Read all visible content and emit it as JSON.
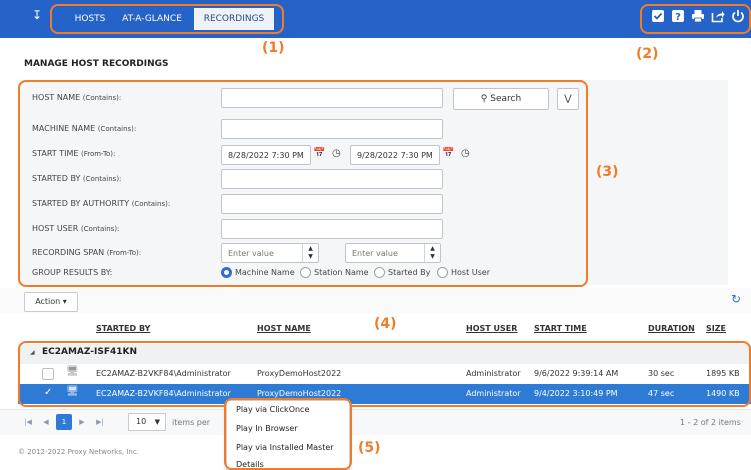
{
  "colors": {
    "topbar": "#2563c9",
    "accent": "#2e7bd6",
    "callout": "#f07c2a"
  },
  "nav": {
    "menu_icon": "double-chevron-down-icon",
    "tabs": [
      {
        "label": "HOSTS"
      },
      {
        "label": "AT-A-GLANCE"
      },
      {
        "label": "RECORDINGS",
        "active": true
      }
    ],
    "tool_icons": [
      "checkbox-icon",
      "help-icon",
      "print-icon",
      "share-icon",
      "power-icon"
    ]
  },
  "callouts": [
    "(1)",
    "(2)",
    "(3)",
    "(4)",
    "(5)"
  ],
  "page_title": "MANAGE HOST RECORDINGS",
  "filters": {
    "host_name": {
      "label": "HOST NAME",
      "hint": "(Contains):",
      "value": ""
    },
    "search_button": "Search",
    "search_icon": "search-icon",
    "reset_icon": "filter-clear-icon",
    "machine_name": {
      "label": "MACHINE NAME",
      "hint": "(Contains):",
      "value": ""
    },
    "start_time": {
      "label": "START TIME",
      "hint": "(From-To):",
      "from": "8/28/2022 7:30 PM",
      "to": "9/28/2022 7:30 PM"
    },
    "started_by": {
      "label": "STARTED BY",
      "hint": "(Contains):",
      "value": ""
    },
    "started_by_authority": {
      "label": "STARTED BY AUTHORITY",
      "hint": "(Contains):",
      "value": ""
    },
    "host_user": {
      "label": "HOST USER",
      "hint": "(Contains):",
      "value": ""
    },
    "recording_span": {
      "label": "RECORDING SPAN",
      "hint": "(From-To):",
      "from_placeholder": "Enter value",
      "to_placeholder": "Enter value"
    },
    "group_results": {
      "label": "GROUP RESULTS BY:",
      "options": [
        "Machine Name",
        "Station Name",
        "Started By",
        "Host User"
      ],
      "selected": "Machine Name"
    }
  },
  "grid": {
    "action_label": "Action ▾",
    "columns": [
      "STARTED BY",
      "HOST NAME",
      "HOST USER",
      "START TIME",
      "DURATION",
      "SIZE"
    ],
    "group": {
      "label": "EC2AMAZ-ISF41KN"
    },
    "rows": [
      {
        "started_by": "EC2AMAZ-B2VKF84\\Administrator",
        "host_name": "ProxyDemoHost2022",
        "host_user": "Administrator",
        "start_time": "9/6/2022 9:39:14 AM",
        "duration": "30 sec",
        "size": "1895 KB",
        "selected": false
      },
      {
        "started_by": "EC2AMAZ-B2VKF84\\Administrator",
        "host_name": "ProxyDemoHost2022",
        "host_user": "Administrator",
        "start_time": "9/4/2022 3:10:49 PM",
        "duration": "47 sec",
        "size": "1490 KB",
        "selected": true
      }
    ]
  },
  "pager": {
    "current_page": "1",
    "page_size": "10",
    "items_per_page": "items per",
    "range": "1 - 2 of 2 items"
  },
  "context_menu": [
    "Play via ClickOnce",
    "Play In Browser",
    "Play via Installed Master",
    "Details"
  ],
  "footer": {
    "copyright": "© 2012-2022 Proxy Networks, Inc."
  }
}
